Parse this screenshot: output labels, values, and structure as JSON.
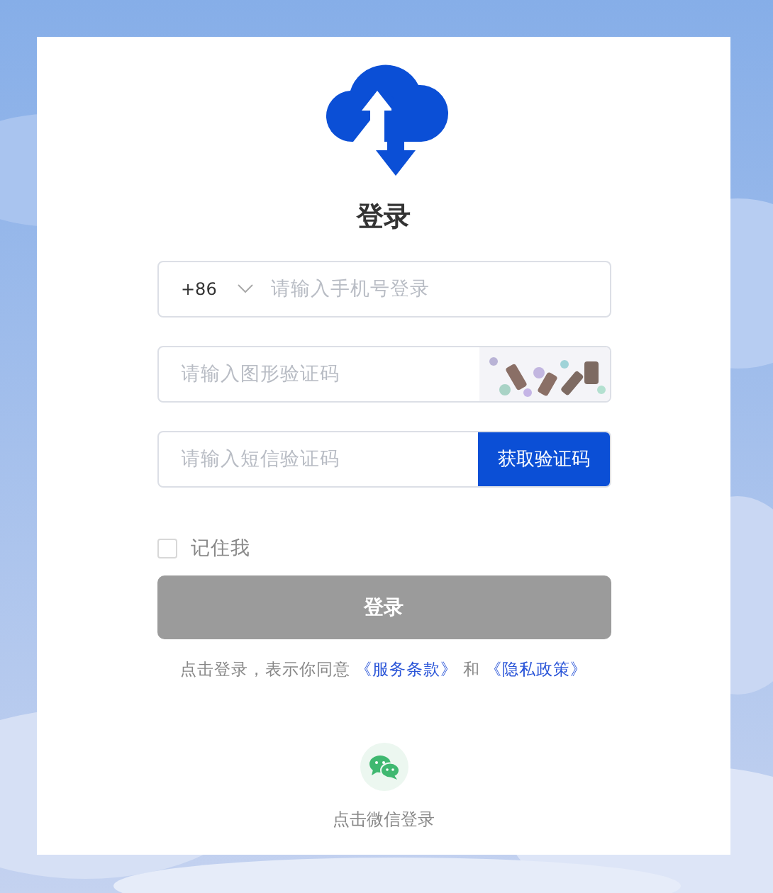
{
  "title": "登录",
  "phone": {
    "country_code": "+86",
    "placeholder": "请输入手机号登录"
  },
  "captcha": {
    "placeholder": "请输入图形验证码"
  },
  "sms": {
    "placeholder": "请输入短信验证码",
    "button": "获取验证码"
  },
  "remember": {
    "label": "记住我",
    "checked": false
  },
  "login_button": {
    "label": "登录",
    "disabled": true
  },
  "agreement": {
    "prefix": "点击登录，表示你同意",
    "joiner": "和",
    "links": [
      "《服务条款》",
      "《隐私政策》"
    ]
  },
  "wechat": {
    "label": "点击微信登录"
  }
}
